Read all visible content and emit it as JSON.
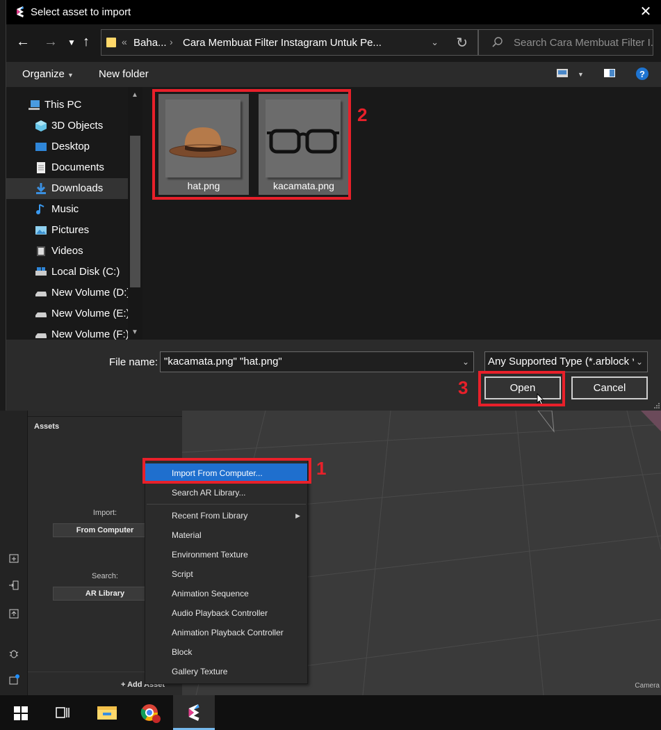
{
  "dialog": {
    "title": "Select asset to import",
    "close_label": "✕",
    "address": {
      "overflow": "«",
      "segment1": "Baha...",
      "segment2": "Cara Membuat Filter Instagram Untuk Pe..."
    },
    "search_placeholder": "Search Cara Membuat Filter I...",
    "toolbar": {
      "organize": "Organize",
      "new_folder": "New folder"
    },
    "tree": [
      {
        "label": "This PC",
        "icon": "pc-icon"
      },
      {
        "label": "3D Objects",
        "icon": "3d-objects-icon"
      },
      {
        "label": "Desktop",
        "icon": "desktop-icon"
      },
      {
        "label": "Documents",
        "icon": "documents-icon"
      },
      {
        "label": "Downloads",
        "icon": "downloads-icon",
        "selected": true
      },
      {
        "label": "Music",
        "icon": "music-icon"
      },
      {
        "label": "Pictures",
        "icon": "pictures-icon"
      },
      {
        "label": "Videos",
        "icon": "videos-icon"
      },
      {
        "label": "Local Disk (C:)",
        "icon": "disk-icon"
      },
      {
        "label": "New Volume (D:)",
        "icon": "drive-icon"
      },
      {
        "label": "New Volume (E:)",
        "icon": "drive-icon"
      },
      {
        "label": "New Volume (F:)",
        "icon": "drive-icon"
      }
    ],
    "files": [
      {
        "name": "hat.png",
        "icon": "hat-thumbnail"
      },
      {
        "name": "kacamata.png",
        "icon": "glasses-thumbnail"
      }
    ],
    "file_name_label": "File name:",
    "file_name_value": "\"kacamata.png\" \"hat.png\"",
    "file_type": "Any Supported Type (*.arblock *",
    "open_label": "Open",
    "cancel_label": "Cancel"
  },
  "annotations": {
    "step1": "1",
    "step2": "2",
    "step3": "3",
    "color": "#e8202a"
  },
  "assets_panel": {
    "title": "Assets",
    "import_label": "Import:",
    "import_button": "From Computer",
    "search_label": "Search:",
    "search_button": "AR Library",
    "add_asset": "+  Add Asset"
  },
  "context_menu": {
    "items": [
      {
        "label": "Import From Computer...",
        "active": true
      },
      {
        "label": "Search AR Library..."
      },
      {
        "label": "Recent From Library",
        "submenu": true
      },
      {
        "label": "Material"
      },
      {
        "label": "Environment Texture"
      },
      {
        "label": "Script"
      },
      {
        "label": "Animation Sequence"
      },
      {
        "label": "Audio Playback Controller"
      },
      {
        "label": "Animation Playback Controller"
      },
      {
        "label": "Block"
      },
      {
        "label": "Gallery Texture"
      }
    ]
  },
  "viewport": {
    "camera_label": "Camera"
  },
  "colors": {
    "accent": "#1f6fce",
    "annotation": "#e8202a",
    "taskbar_accent": "#76b9ed"
  }
}
